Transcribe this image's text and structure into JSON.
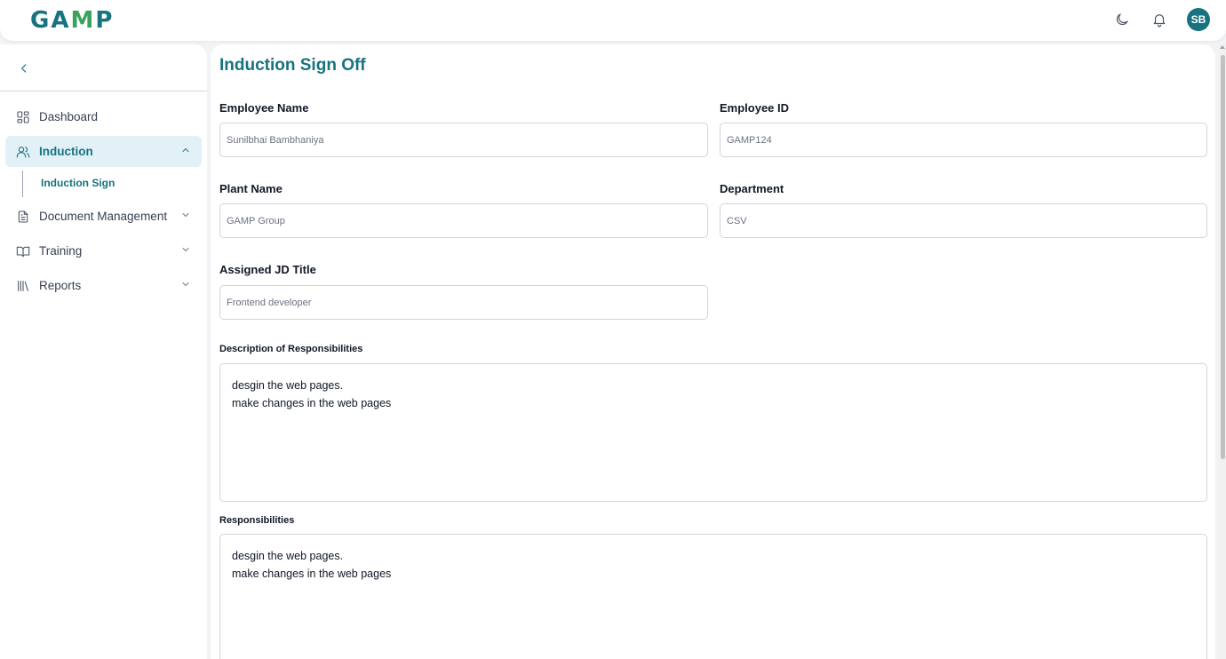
{
  "header": {
    "logo_text_pre": "GA",
    "logo_text_leaf": "M",
    "logo_text_post": "P",
    "theme_icon": "moon-icon",
    "notif_icon": "bell-icon",
    "user_initials": "SB"
  },
  "sidebar": {
    "collapse_icon": "chevron-left-icon",
    "items": [
      {
        "label": "Dashboard",
        "icon": "dashboard-grid-icon"
      },
      {
        "label": "Induction",
        "icon": "users-icon",
        "active": true,
        "expanded": true
      },
      {
        "label": "Document Management",
        "icon": "document-icon"
      },
      {
        "label": "Training",
        "icon": "book-open-icon"
      },
      {
        "label": "Reports",
        "icon": "library-icon"
      }
    ],
    "subitem": {
      "label": "Induction Sign"
    }
  },
  "main": {
    "title": "Induction Sign Off",
    "fields": {
      "employee_name": {
        "label": "Employee Name",
        "value": "Sunilbhai Bambhaniya"
      },
      "employee_id": {
        "label": "Employee ID",
        "value": "GAMP124"
      },
      "plant_name": {
        "label": "Plant Name",
        "value": "GAMP Group"
      },
      "department": {
        "label": "Department",
        "value": "CSV"
      },
      "jd_title": {
        "label": "Assigned JD Title",
        "value": "Frontend developer"
      },
      "description": {
        "label": "Description of Responsibilities",
        "line1": "desgin the web pages.",
        "line2": "make changes in the web pages"
      },
      "responsibilities": {
        "label": "Responsibilities",
        "line1": "desgin the web pages.",
        "line2": "make changes in the web pages"
      }
    }
  },
  "colors": {
    "brand": "#16737f",
    "active_bg": "#e2f1f8",
    "page_bg": "#f1f3f5"
  }
}
